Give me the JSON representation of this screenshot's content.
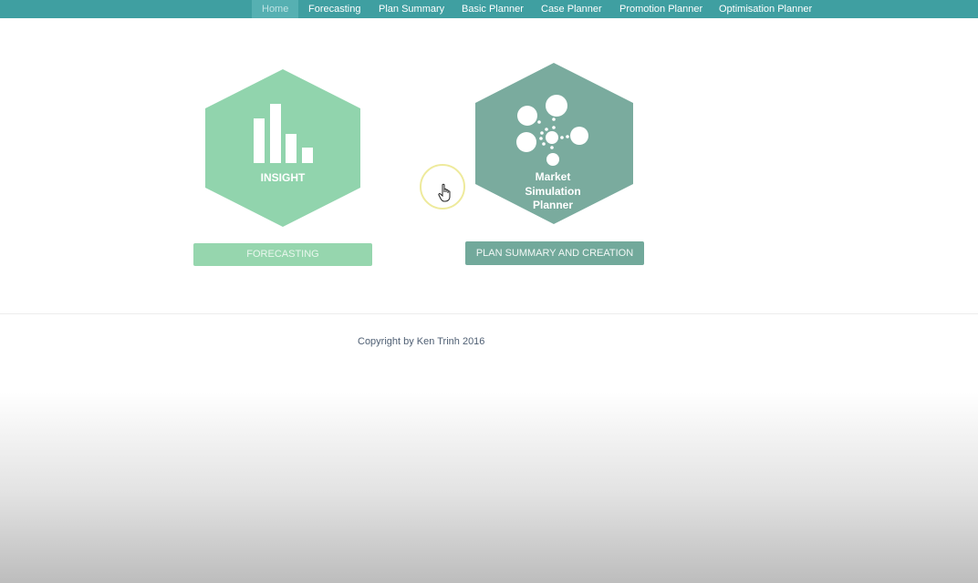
{
  "nav": {
    "items": [
      {
        "label": "Home",
        "active": true
      },
      {
        "label": "Forecasting",
        "active": false
      },
      {
        "label": "Plan Summary",
        "active": false
      },
      {
        "label": "Basic Planner",
        "active": false
      },
      {
        "label": "Case Planner",
        "active": false
      },
      {
        "label": "Promotion Planner",
        "active": false
      },
      {
        "label": "Optimisation Planner",
        "active": false
      }
    ]
  },
  "insight_tile": {
    "title": "INSIGHT",
    "icon": "bar-chart-icon",
    "color": "#91d4ad",
    "button_label": "FORECASTING"
  },
  "market_tile": {
    "title_lines": [
      "Market",
      "Simulation",
      "Planner"
    ],
    "icon": "network-bubbles-icon",
    "color": "#7aab9e",
    "button_label": "PLAN SUMMARY AND CREATION"
  },
  "footer": {
    "copyright": "Copyright by Ken Trinh 2016"
  },
  "cursor": {
    "icon": "pointer-hand-icon"
  }
}
